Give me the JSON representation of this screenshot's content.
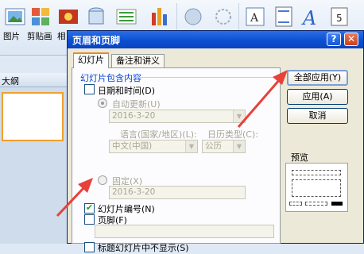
{
  "ribbon": {
    "labels": {
      "picture": "图片",
      "clipart": "剪贴画",
      "album_partial": "相"
    },
    "icons": [
      "picture-icon",
      "clipart-icon",
      "photo-album-icon",
      "shapes-icon",
      "smartart-icon",
      "chart-icon",
      "hyperlink-icon",
      "action-icon",
      "textbox-icon",
      "header-footer-icon",
      "wordart-icon",
      "date-time-icon",
      "slide-number-icon"
    ]
  },
  "left_pane": {
    "outline_tab": "大纲"
  },
  "dialog": {
    "title": "页眉和页脚",
    "help_button": "?",
    "close_button": "✕",
    "tabs": [
      {
        "label": "幻灯片",
        "active": true
      },
      {
        "label": "备注和讲义",
        "active": false
      }
    ],
    "group_title": "幻灯片包含内容",
    "date_time": {
      "label": "日期和时间",
      "accel": "(D)",
      "checked": false
    },
    "auto_update": {
      "label": "自动更新",
      "accel": "(U)",
      "selected": true,
      "value": "2016-3-20"
    },
    "language_label": "语言(国家/地区)",
    "language_accel": "(L):",
    "language_value": "中文(中国)",
    "calendar_label": "日历类型",
    "calendar_accel": "(C):",
    "calendar_value": "公历",
    "fixed": {
      "label": "固定",
      "accel": "(X)",
      "selected": false,
      "value": "2016-3-20"
    },
    "slide_number": {
      "label": "幻灯片编号",
      "accel": "(N)",
      "checked": true
    },
    "footer": {
      "label": "页脚",
      "accel": "(F)",
      "checked": false,
      "value": ""
    },
    "hide_on_title": {
      "label": "标题幻灯片中不显示",
      "accel": "(S)",
      "checked": false
    },
    "buttons": {
      "apply_all": "全部应用(Y)",
      "apply": "应用(A)",
      "cancel": "取消"
    },
    "preview_label": "预览",
    "check_glyph": "✔",
    "accent_color": "#0046d5",
    "arrow_color": "#e8413a"
  }
}
